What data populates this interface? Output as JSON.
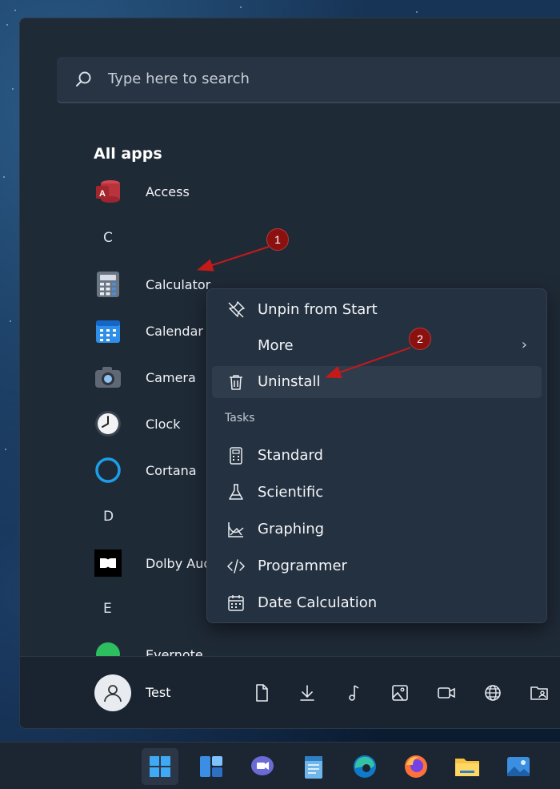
{
  "search": {
    "placeholder": "Type here to search"
  },
  "all_apps": {
    "title": "All apps",
    "items": [
      {
        "type": "app",
        "label": "Access",
        "icon": "access-icon"
      },
      {
        "type": "letter",
        "label": "C"
      },
      {
        "type": "app",
        "label": "Calculator",
        "icon": "calculator-icon"
      },
      {
        "type": "app",
        "label": "Calendar",
        "icon": "calendar-icon"
      },
      {
        "type": "app",
        "label": "Camera",
        "icon": "camera-icon"
      },
      {
        "type": "app",
        "label": "Clock",
        "icon": "clock-icon"
      },
      {
        "type": "app",
        "label": "Cortana",
        "icon": "cortana-icon"
      },
      {
        "type": "letter",
        "label": "D"
      },
      {
        "type": "app",
        "label": "Dolby Aud",
        "icon": "dolby-icon"
      },
      {
        "type": "letter",
        "label": "E"
      },
      {
        "type": "app",
        "label": "Evernote",
        "icon": "evernote-icon"
      }
    ]
  },
  "user": {
    "name": "Test"
  },
  "bottom_icons": [
    "documents-icon",
    "downloads-icon",
    "music-icon",
    "pictures-icon",
    "videos-icon",
    "network-icon",
    "personal-folder-icon"
  ],
  "context_menu": {
    "items": [
      {
        "label": "Unpin from Start",
        "icon": "unpin-icon"
      },
      {
        "label": "More",
        "icon": ""
      },
      {
        "label": "Uninstall",
        "icon": "trash-icon"
      }
    ],
    "section_label": "Tasks",
    "tasks": [
      {
        "label": "Standard",
        "icon": "standard-calculator-icon"
      },
      {
        "label": "Scientific",
        "icon": "flask-icon"
      },
      {
        "label": "Graphing",
        "icon": "graph-icon"
      },
      {
        "label": "Programmer",
        "icon": "code-icon"
      },
      {
        "label": "Date Calculation",
        "icon": "calendar-grid-icon"
      }
    ]
  },
  "annotations": {
    "badge1": "1",
    "badge2": "2",
    "color": "#8b1111"
  },
  "taskbar": {
    "icons": [
      "start-icon",
      "widgets-icon",
      "teams-chat-icon",
      "notepad-icon",
      "edge-icon",
      "firefox-icon",
      "file-explorer-icon",
      "photos-icon"
    ]
  }
}
